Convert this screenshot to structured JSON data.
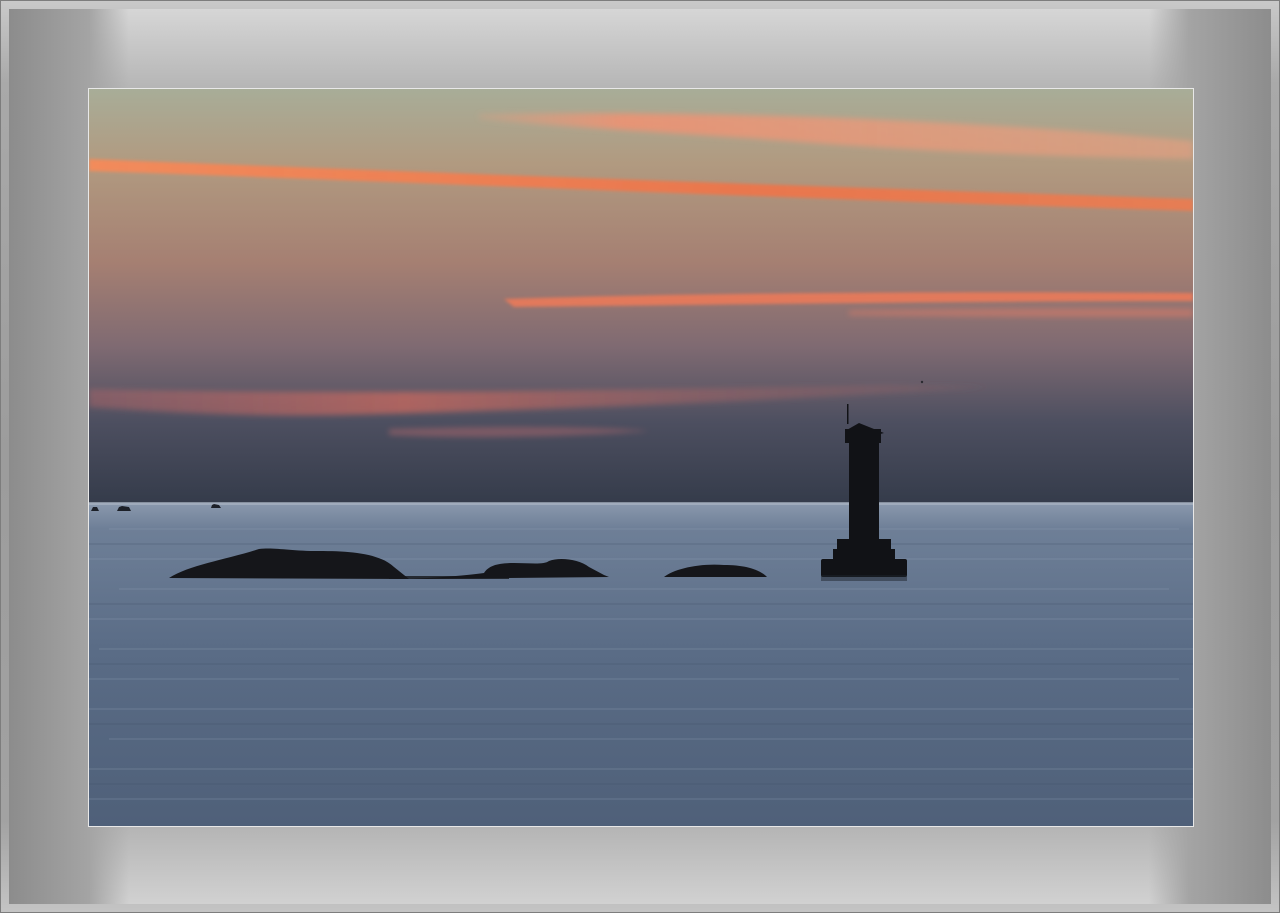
{
  "scene": {
    "subject": "lighthouse-at-dusk",
    "colors": {
      "sky_top": "#a9ad98",
      "sky_mid": "#a98878",
      "sky_low": "#6e6672",
      "horizon": "#353c4a",
      "sea_top": "#6e7f97",
      "sea_bottom": "#4d5f7a",
      "cloud_streak": "#f07a4d",
      "silhouette": "#141418",
      "frame": "#a0a0a0",
      "mat_border": "#e8e8e8"
    }
  }
}
